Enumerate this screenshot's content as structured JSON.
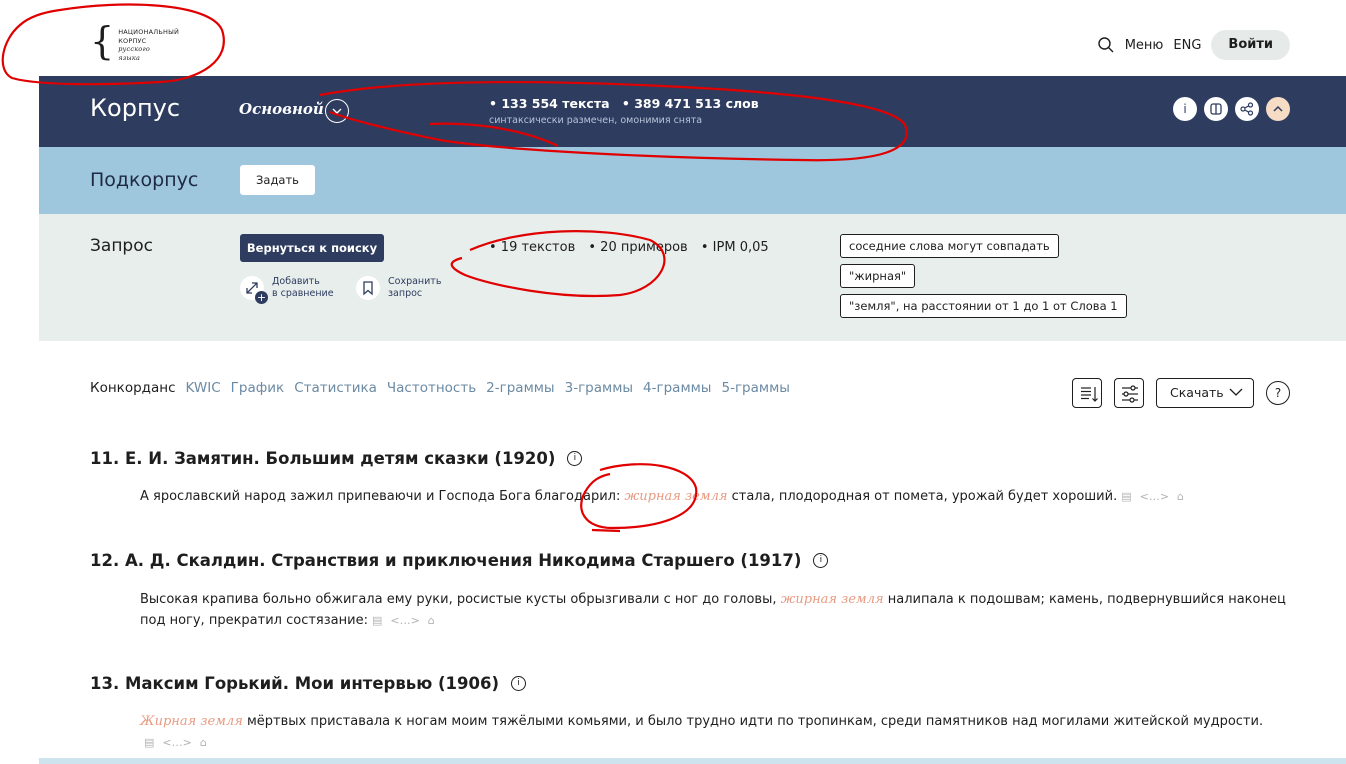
{
  "header": {
    "logo": {
      "line1": "НАЦИОНАЛЬНЫЙ",
      "line2": "КОРПУС",
      "line3": "русского",
      "line4": "языка"
    },
    "menu_label": "Меню",
    "lang_label": "ENG",
    "login_label": "Войти"
  },
  "corpus": {
    "title": "Корпус",
    "type": "Основной",
    "texts": "• 133 554 текста",
    "words": "• 389 471 513 слов",
    "subtitle": "синтаксически размечен, омонимия снята",
    "info_glyph": "i"
  },
  "subcorpus": {
    "title": "Подкорпус",
    "set_button": "Задать"
  },
  "query": {
    "title": "Запрос",
    "back_button": "Вернуться к поиску",
    "compare_line1": "Добавить",
    "compare_line2": "в сравнение",
    "save_line1": "Сохранить",
    "save_line2": "запрос",
    "stats": {
      "texts": "• 19 текстов",
      "examples": "• 20 примеров",
      "ipm": "• IPM 0,05"
    },
    "tags": [
      "соседние слова могут совпадать",
      "\"жирная\"",
      "\"земля\", на расстоянии от 1 до 1 от Слова 1"
    ]
  },
  "tabs": [
    "Конкорданс",
    "KWIC",
    "График",
    "Статистика",
    "Частотность",
    "2-граммы",
    "3-граммы",
    "4-граммы",
    "5-граммы"
  ],
  "tools": {
    "download_label": "Скачать",
    "help_glyph": "?"
  },
  "results": [
    {
      "title": "11. Е. И. Замятин. Большим детям сказки (1920)",
      "before": "А ярославский народ зажил припеваючи и Господа Бога благодарил: ",
      "hit": "жирная земля",
      "after": " стала, плодородная от помета, урожай будет хороший."
    },
    {
      "title": "12. А. Д. Скалдин. Странствия и приключения Никодима Старшего (1917)",
      "before": "Высокая крапива больно обжигала ему руки, росистые кусты обрызгивали с ног до головы, ",
      "hit": "жирная земля",
      "after": " налипала к подошвам; камень, подвернувшийся наконец под ногу, прекратил состязание:"
    },
    {
      "title": "13. Максим Горький. Мои интервью (1906)",
      "before": "",
      "hit": "Жирная земля",
      "after": " мёртвых приставала к ногам моим тяжёлыми комьями, и было трудно идти по тропинкам, среди памятников над могилами житейской мудрости."
    }
  ],
  "colors": {
    "navy": "#2e3c5f",
    "light_blue": "#9ec6dd",
    "query_bg": "#e8eeec",
    "hit": "#e99a82",
    "tab_link": "#6b8aa3",
    "annotation": "#e00000"
  }
}
